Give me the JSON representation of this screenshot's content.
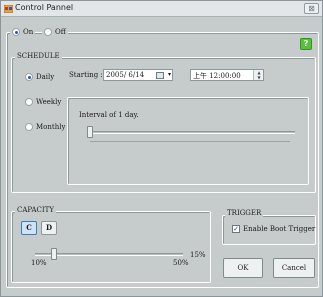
{
  "window": {
    "title": "Control Pannel",
    "close_glyph": "⊠"
  },
  "power": {
    "on_label": "On",
    "off_label": "Off",
    "selected": "On"
  },
  "help": {
    "label": "?",
    "color": "#58c13a"
  },
  "schedule": {
    "legend": "SCHEDULE",
    "modes": [
      "Daily",
      "Weekly",
      "Monthly"
    ],
    "selected_mode": "Daily",
    "starting_label": "Starting :",
    "date_value": "2005/ 6/14",
    "time_value": "上午 12:00:00",
    "interval_label": "Interval of 1    day.",
    "interval_value": 1
  },
  "capacity": {
    "legend": "CAPACITY",
    "buttons": [
      "C",
      "D"
    ],
    "selected_drive": "C",
    "current_label": "15%",
    "min_label": "10%",
    "max_label": "50%",
    "value": 15
  },
  "trigger": {
    "legend": "TRIGGER",
    "checkbox_label": "Enable Boot Trigger",
    "checked": true
  },
  "actions": {
    "ok_label": "OK",
    "cancel_label": "Cancel"
  }
}
